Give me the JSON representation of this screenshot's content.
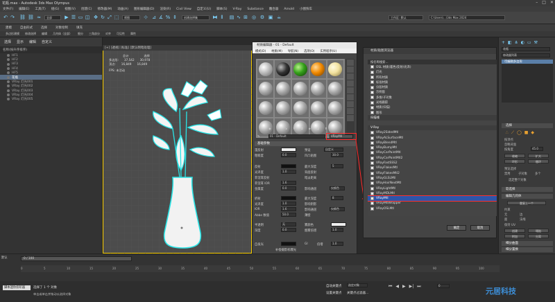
{
  "title": "花瓶.max - Autodesk 3ds Max Olympus",
  "menus": [
    "文件(F)",
    "编辑(E)",
    "工具(T)",
    "组(G)",
    "视图(V)",
    "创建(C)",
    "修改器(M)",
    "动画(A)",
    "图形编辑器(D)",
    "渲染(R)",
    "Civil View",
    "自定义(U)",
    "脚本(S)",
    "V-Ray",
    "Substance",
    "雕合器",
    "Arnold",
    "小图快车"
  ],
  "toolbar": {
    "filter": "全部",
    "selection_set": "创建选择集",
    "workspace": "工作区: 默认",
    "project_path": "C:\\Users\\...\\3ds Max 2024"
  },
  "ribbon_tabs": [
    "建模",
    "自由形式",
    "选择",
    "对象绘制",
    "填充"
  ],
  "ribbon_sub": [
    "多边形建模",
    "修改选择",
    "编辑",
    "几何体（全部）",
    "细分",
    "三角剖分",
    "对齐",
    "可见性",
    "属性"
  ],
  "scene_explorer": {
    "tabs": [
      "选择",
      "显示",
      "编辑",
      "自定义"
    ],
    "header": "名称(按升序排序)",
    "items": [
      "HF1",
      "HF2",
      "HF3",
      "HF4",
      "HF5",
      "花瓶",
      "VRay 灯光001",
      "VRay 灯光002",
      "VRay 灯光003",
      "VRay 灯光004",
      "VRay 灯光005"
    ],
    "selected": "花瓶"
  },
  "viewport": {
    "label": "[+] [透视] [标准] [默认明暗处理]",
    "stats_header": [
      "总计",
      "选择"
    ],
    "stats_rows": [
      [
        "多边形:",
        "37,542",
        "30,978"
      ],
      [
        "顶点:",
        "16,849",
        "16,849"
      ]
    ],
    "fps": "FPS: 未活动"
  },
  "material_editor": {
    "title": "材质编辑器 - 01 - Default",
    "menu": [
      "模式(D)",
      "材质(M)",
      "导航(N)",
      "选项(O)",
      "实用程序(U)"
    ],
    "material_name": "01 - Default",
    "material_type": "VRayMtl",
    "sections": {
      "basic": "基础参数",
      "brdf": "双向反射分布",
      "options": "选项",
      "maps": "贴图",
      "mental": "mental ray 连接"
    },
    "diffuse_label": "漫反射",
    "roughness_label": "粗糙度",
    "preset_label": "预设",
    "preset_value": "自定义",
    "roughness_value": "0.0",
    "ao_label": "凹凸贴图",
    "ao_value": "30.0",
    "reflect_label": "反射",
    "gloss_label": "光泽度",
    "fresnel_label": "菲涅耳反射",
    "fresnel_ior": "菲涅耳 IOR",
    "metal_label": "金属度",
    "max_depth": "最大深度",
    "max_depth_val": "5",
    "backside": "背面反射",
    "dim_dist": "暗淡距离",
    "affect_ch": "影响通道",
    "affect_val": "仅颜色",
    "refract_label": "折射",
    "ior_label": "IOR",
    "abbe_label": "Abbe 数值",
    "thin_label": "薄壁",
    "affect_shadows": "影响阴影",
    "translucency": "半透明",
    "scatter_color": "雾颜色",
    "depth_label": "深度",
    "fog_bias": "烟雾倍增",
    "self_illum": "自发光",
    "gi_label": "GI",
    "mult": "倍增",
    "mult_val": "1.0",
    "comp_cam": "补偿摄影机曝光",
    "values": {
      "v1": "1.0",
      "v2": "0.0",
      "v3": "1.6",
      "v4": "200",
      "v5": "0.0",
      "v6": "1.6",
      "v7": "50.0",
      "v8": "1.0",
      "v9": "0.0",
      "v10": "8",
      "v11": "1.0",
      "v12": "0.0"
    }
  },
  "browser": {
    "title": "材质/贴图浏览器",
    "search": "按名称搜索...",
    "groups_top": [
      "OSL 材质(着色/反射/光泽)",
      "灯光",
      "所有材质",
      "标准材质",
      "分层材质",
      "示例窗",
      "多维/子对象",
      "光线跟踪",
      "材质(扫描)",
      "图形"
    ],
    "group_vray": "V-Ray",
    "group_scene": "扫描线",
    "vray_items": [
      "VRay2SidedMtl",
      "VRayALSurfaceMtl",
      "VRayBlendMtl",
      "VRayBumpMtl",
      "VRayCarPaintMtl",
      "VRayCarPaintMtl2",
      "VRayFastSSS2",
      "VRayFlakesMtl",
      "VRayFlakesMtl2",
      "VRayGLSLMtl",
      "VRayHairNextMtl",
      "VRayLightMtl",
      "VRayMDLMtl",
      "VRayMtl",
      "VRayMtlWrapper",
      "VRayOSLMtl"
    ],
    "selected": "VRayMtl",
    "ok": "确定",
    "cancel": "取消"
  },
  "command_panel": {
    "object_name": "花瓶",
    "modifier_list": "修改器列表",
    "stack_item": "可编辑多边形",
    "selection": "选择",
    "by_vertex": "按顶点",
    "ignore_back": "忽略背面",
    "by_angle": "按角度",
    "angle": "45.0",
    "shrink": "收缩",
    "grow": "扩大",
    "ring": "环形",
    "loop": "循环",
    "preview": "预览选择",
    "off": "禁用",
    "subobj": "子对象",
    "multi": "多个",
    "whole": "选定整个对象",
    "soft": "软选择",
    "edit_geo": "编辑几何体",
    "repeat": "重复上一个",
    "constraints": "约束",
    "none": "无",
    "edge": "边",
    "face": "面",
    "normal": "法线",
    "preserve_uv": "保持 UV",
    "create": "创建",
    "collapse": "塌陷",
    "attach": "附加",
    "detach": "分离",
    "subdiv": "细分曲面",
    "subdiv_disp": "细分置换"
  },
  "timeline": {
    "frame": "0 / 100",
    "ticks": [
      "0",
      "5",
      "10",
      "15",
      "20",
      "25",
      "30",
      "35",
      "40",
      "45",
      "50",
      "55",
      "60",
      "65",
      "70",
      "75",
      "80",
      "85",
      "90",
      "95",
      "100"
    ]
  },
  "status": {
    "selected": "选择了 1 个 对象",
    "hint": "单击或单击并拖动以选择对象",
    "auto_key": "自动关键点",
    "selected_obj": "选定对象",
    "set_key": "设置关键点",
    "filter": "关键点过滤器...",
    "frame_val": "0",
    "default": "默认"
  },
  "watermark": "元居科技",
  "colors": {
    "accent": "#7fd4ff",
    "highlight": "#ff2a2a",
    "select": "#2e55aa"
  }
}
